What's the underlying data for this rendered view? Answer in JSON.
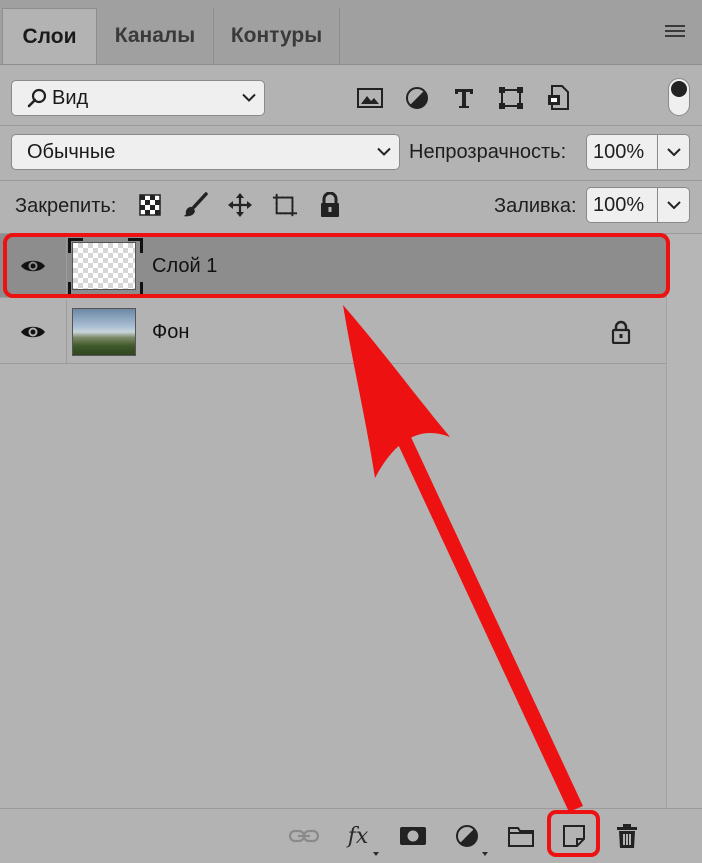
{
  "tabs": [
    {
      "label": "Слои",
      "active": true
    },
    {
      "label": "Каналы",
      "active": false
    },
    {
      "label": "Контуры",
      "active": false
    }
  ],
  "filter": {
    "selected": "Вид",
    "icons": [
      "image-filter-icon",
      "adjustment-filter-icon",
      "type-filter-icon",
      "shape-filter-icon",
      "smart-object-filter-icon"
    ]
  },
  "blend_mode": {
    "selected": "Обычные"
  },
  "opacity": {
    "label": "Непрозрачность:",
    "value": "100%"
  },
  "lock": {
    "label": "Закрепить:",
    "icons": [
      "lock-transparent-pixels-icon",
      "lock-image-pixels-icon",
      "lock-position-icon",
      "lock-artboard-icon",
      "lock-all-icon"
    ]
  },
  "fill": {
    "label": "Заливка:",
    "value": "100%"
  },
  "layers": [
    {
      "name": "Слой 1",
      "selected": true,
      "visible": true,
      "locked": false,
      "thumbnail": "transparent"
    },
    {
      "name": "Фон",
      "selected": false,
      "visible": true,
      "locked": true,
      "thumbnail": "photo"
    }
  ],
  "bottom_toolbar": {
    "icons": [
      "link-layers-icon",
      "fx-icon",
      "add-mask-icon",
      "adjustment-layer-icon",
      "new-group-icon",
      "new-layer-icon",
      "delete-layer-icon"
    ],
    "fx_label": "fx"
  },
  "annotation": {
    "color": "#ee1111"
  },
  "colors": {
    "panel_bg": "#b3b3b3",
    "selected_layer": "#8d8d8d",
    "tab_bar": "#a0a0a0"
  }
}
